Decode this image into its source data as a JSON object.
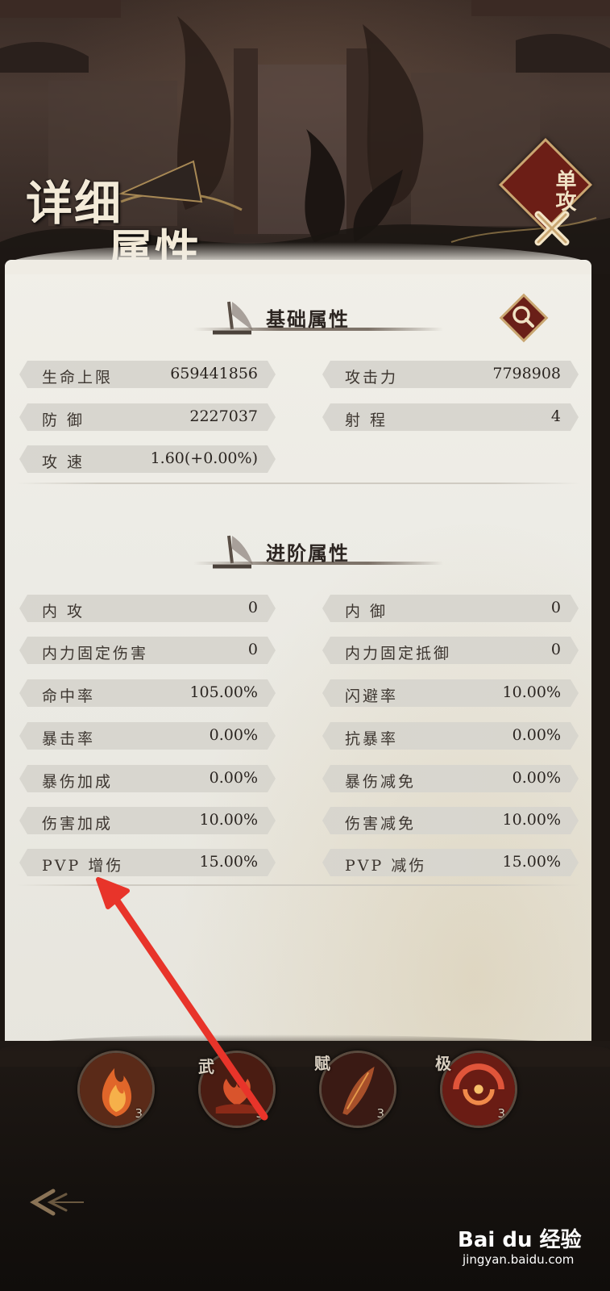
{
  "title": {
    "line1": "详细",
    "line2": "属性"
  },
  "mode_badge": "单攻",
  "sections": {
    "basic": {
      "title": "基础属性",
      "rows": [
        {
          "left": {
            "label": "生命上限",
            "value": "659441856"
          },
          "right": {
            "label": "攻击力",
            "value": "7798908"
          }
        },
        {
          "left": {
            "label": "防  御",
            "value": "2227037"
          },
          "right": {
            "label": "射  程",
            "value": "4"
          }
        },
        {
          "left": {
            "label": "攻  速",
            "value": "1.60(+0.00%)"
          }
        }
      ]
    },
    "advanced": {
      "title": "进阶属性",
      "rows": [
        {
          "left": {
            "label": "内  攻",
            "value": "0"
          },
          "right": {
            "label": "内  御",
            "value": "0"
          }
        },
        {
          "left": {
            "label": "内力固定伤害",
            "value": "0"
          },
          "right": {
            "label": "内力固定抵御",
            "value": "0"
          }
        },
        {
          "left": {
            "label": "命中率",
            "value": "105.00%"
          },
          "right": {
            "label": "闪避率",
            "value": "10.00%"
          }
        },
        {
          "left": {
            "label": "暴击率",
            "value": "0.00%"
          },
          "right": {
            "label": "抗暴率",
            "value": "0.00%"
          }
        },
        {
          "left": {
            "label": "暴伤加成",
            "value": "0.00%"
          },
          "right": {
            "label": "暴伤减免",
            "value": "0.00%"
          }
        },
        {
          "left": {
            "label": "伤害加成",
            "value": "10.00%"
          },
          "right": {
            "label": "伤害减免",
            "value": "10.00%"
          }
        },
        {
          "left": {
            "label": "PVP 增伤",
            "value": "15.00%"
          },
          "right": {
            "label": "PVP 减伤",
            "value": "15.00%"
          }
        }
      ]
    }
  },
  "skills": [
    {
      "tag": "",
      "level": "3",
      "icon": "flame-skill-icon"
    },
    {
      "tag": "武",
      "level": "3",
      "icon": "lotus-skill-icon"
    },
    {
      "tag": "赋",
      "level": "3",
      "icon": "feather-skill-icon"
    },
    {
      "tag": "极",
      "level": "3",
      "icon": "vortex-skill-icon"
    }
  ],
  "watermark": {
    "brand": "Bai du 经验",
    "url": "jingyan.baidu.com"
  },
  "colors": {
    "badge_red": "#6c1e16",
    "gold_border": "#c9a671",
    "annotation_red": "#e8342a",
    "parchment": "#ecebe5"
  }
}
